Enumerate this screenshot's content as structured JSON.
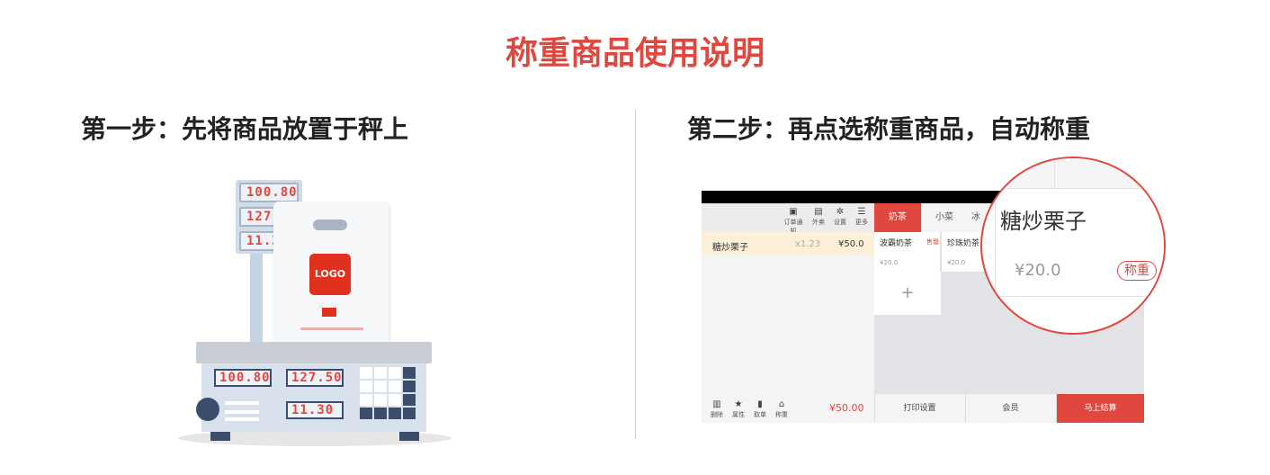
{
  "page": {
    "title": "称重商品使用说明",
    "step1": "第一步：先将商品放置于秤上",
    "step2": "第二步：再点选称重商品，自动称重"
  },
  "scale": {
    "head_displays": [
      "100.80",
      "127.50",
      "11.30"
    ],
    "bag_logo": "LOGO",
    "body_displays": [
      "100.80",
      "127.50",
      "11.30"
    ]
  },
  "pos": {
    "toolbar": [
      {
        "icon": "notice-icon",
        "label": "订单通知"
      },
      {
        "icon": "takeout-icon",
        "label": "外卖"
      },
      {
        "icon": "settings-icon",
        "label": "设置"
      },
      {
        "icon": "more-icon",
        "label": "更多"
      }
    ],
    "tabs": [
      "奶茶",
      "小菜",
      "冰"
    ],
    "order": {
      "name": "糖炒栗子",
      "qty": "x1.23",
      "price": "¥50.0"
    },
    "products": [
      {
        "name": "波霸奶茶",
        "tag": "售罄",
        "price": "¥20.0"
      },
      {
        "name": "珍珠奶茶",
        "tag": "",
        "price": "¥20.0"
      }
    ],
    "add_symbol": "+",
    "bottom_actions": [
      {
        "icon": "delete-icon",
        "label": "删除"
      },
      {
        "icon": "star-icon",
        "label": "属性"
      },
      {
        "icon": "order-icon",
        "label": "取单"
      },
      {
        "icon": "scale-icon",
        "label": "称重"
      }
    ],
    "total": "¥50.00",
    "print_settings": "打印设置",
    "member": "会员",
    "checkout": "马上结算"
  },
  "magnifier": {
    "name": "糖炒栗子",
    "price": "¥20.0",
    "weigh_button": "称重"
  },
  "colors": {
    "accent": "#e0473e",
    "scale_dark": "#3a4d6a",
    "order_highlight": "#fdf0d9"
  }
}
